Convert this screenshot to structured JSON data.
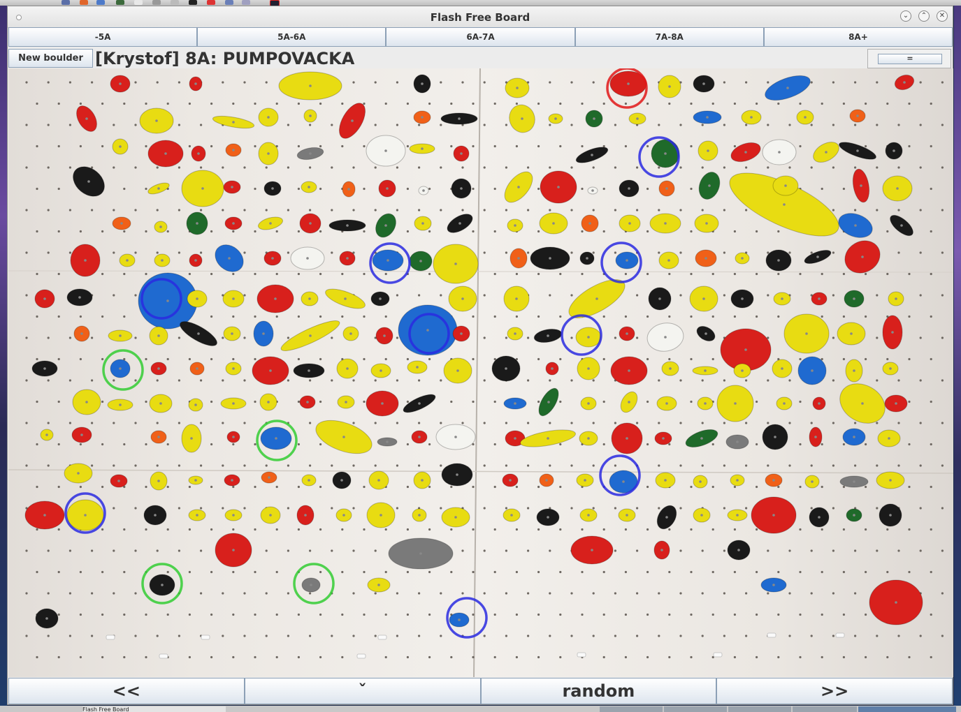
{
  "window": {
    "title": "Flash Free Board",
    "controls": {
      "minimize": "⌄",
      "maximize": "⌃",
      "close": "✕"
    }
  },
  "grade_tabs": [
    "-5A",
    "5A-6A",
    "6A-7A",
    "7A-8A",
    "8A+"
  ],
  "toolbar": {
    "new_boulder_label": "New boulder",
    "boulder_title": "[Krystof] 8A: PUMPOVACKA",
    "menu_button_label": "="
  },
  "navigation": {
    "prev_label": "<<",
    "dropdown_label": "ˇ",
    "random_label": "random",
    "next_label": ">>"
  },
  "taskbar": {
    "active_item": "Flash Free Board"
  },
  "marker_colors": {
    "start": "#2a2ae0",
    "hand": "#2a2ae0",
    "foot": "#33cc33",
    "top": "#e01818"
  }
}
